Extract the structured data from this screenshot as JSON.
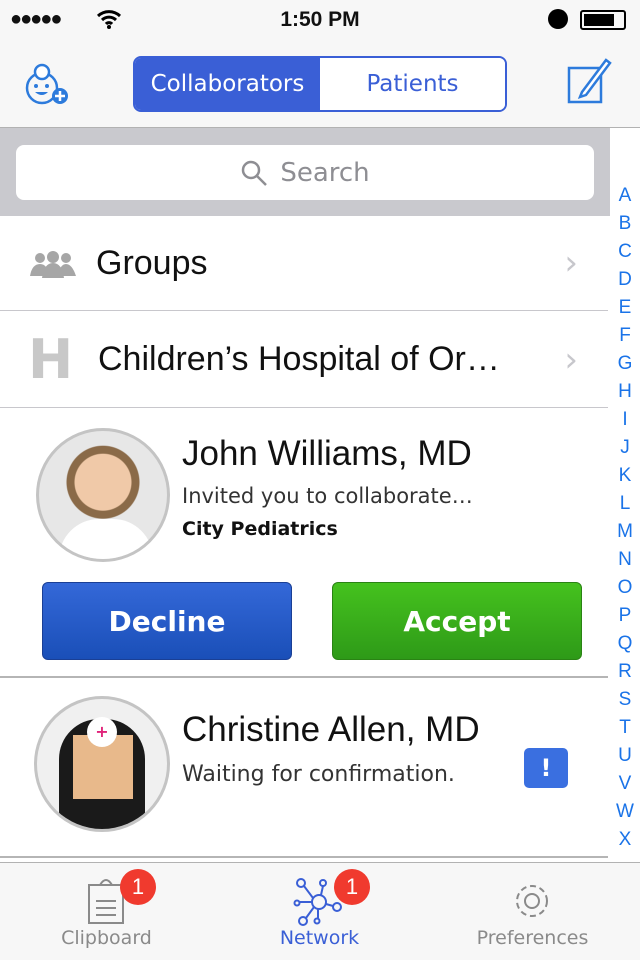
{
  "status": {
    "time": "1:50 PM",
    "signal_dots": 5
  },
  "nav": {
    "segments": [
      "Collaborators",
      "Patients"
    ],
    "selected": "Collaborators",
    "add_icon": "doctor-add-icon",
    "compose_icon": "compose-icon"
  },
  "search": {
    "placeholder": "Search"
  },
  "index": [
    "A",
    "B",
    "C",
    "D",
    "E",
    "F",
    "G",
    "H",
    "I",
    "J",
    "K",
    "L",
    "M",
    "N",
    "O",
    "P",
    "Q",
    "R",
    "S",
    "T",
    "U",
    "V",
    "W",
    "X"
  ],
  "rows": {
    "groups": "Groups",
    "hospital": "Children’s Hospital of Or…"
  },
  "invite": {
    "name": "John Williams, MD",
    "message": "Invited you to collaborate…",
    "org": "City Pediatrics",
    "decline": "Decline",
    "accept": "Accept"
  },
  "pending": {
    "name": "Christine Allen, MD",
    "message": "Waiting for confirmation.",
    "alert": "!"
  },
  "tabs": [
    {
      "label": "Clipboard",
      "badge": "1"
    },
    {
      "label": "Network",
      "badge": "1"
    },
    {
      "label": "Preferences"
    }
  ],
  "colors": {
    "accent": "#3a5fd6",
    "decline": "#1f55c8",
    "accept": "#3aaa1e",
    "badge": "#f03a2e"
  }
}
